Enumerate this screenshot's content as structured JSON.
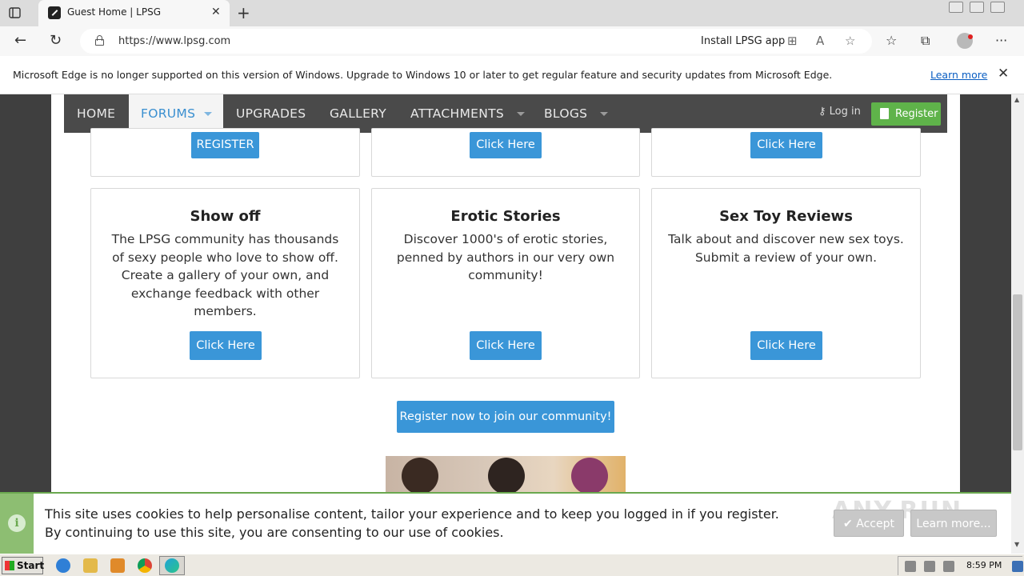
{
  "browser": {
    "tab_title": "Guest Home | LPSG",
    "url": "https://www.lpsg.com",
    "install_app_label": "Install LPSG app",
    "icons": [
      "tab-actions-icon",
      "favicon-icon",
      "close-tab-icon",
      "new-tab-icon",
      "back-icon",
      "refresh-icon",
      "lock-icon",
      "app-install-icon",
      "read-aloud-icon",
      "add-favorite-icon",
      "favorites-icon",
      "collections-icon",
      "profile-avatar",
      "more-icon"
    ]
  },
  "infobar": {
    "message": "Microsoft Edge is no longer supported on this version of Windows. Upgrade to Windows 10 or later to get regular feature and security updates from Microsoft Edge.",
    "learn_more": "Learn more"
  },
  "site_nav": {
    "items": [
      {
        "label": "HOME"
      },
      {
        "label": "FORUMS"
      },
      {
        "label": "UPGRADES"
      },
      {
        "label": "GALLERY"
      },
      {
        "label": "ATTACHMENTS"
      },
      {
        "label": "BLOGS"
      }
    ],
    "login": "Log in",
    "register": "Register"
  },
  "top_cards": [
    {
      "button": "REGISTER"
    },
    {
      "button": "Click Here"
    },
    {
      "button": "Click Here"
    }
  ],
  "cards": [
    {
      "title": "Show off",
      "text": "The LPSG community has thousands of sexy people who love to show off. Create a gallery of your own, and exchange feedback with other members.",
      "button": "Click Here"
    },
    {
      "title": "Erotic Stories",
      "text": "Discover 1000's of erotic stories, penned by authors in our very own community!",
      "button": "Click Here"
    },
    {
      "title": "Sex Toy Reviews",
      "text": "Talk about and discover new sex toys. Submit a review of your own.",
      "button": "Click Here"
    }
  ],
  "register_cta": "Register now to join our community!",
  "cookie": {
    "line1": "This site uses cookies to help personalise content, tailor your experience and to keep you logged in if you register.",
    "line2": "By continuing to use this site, you are consenting to our use of cookies.",
    "accept": "Accept",
    "learn_more": "Learn more..."
  },
  "taskbar": {
    "start": "Start",
    "clock": "8:59 PM"
  }
}
